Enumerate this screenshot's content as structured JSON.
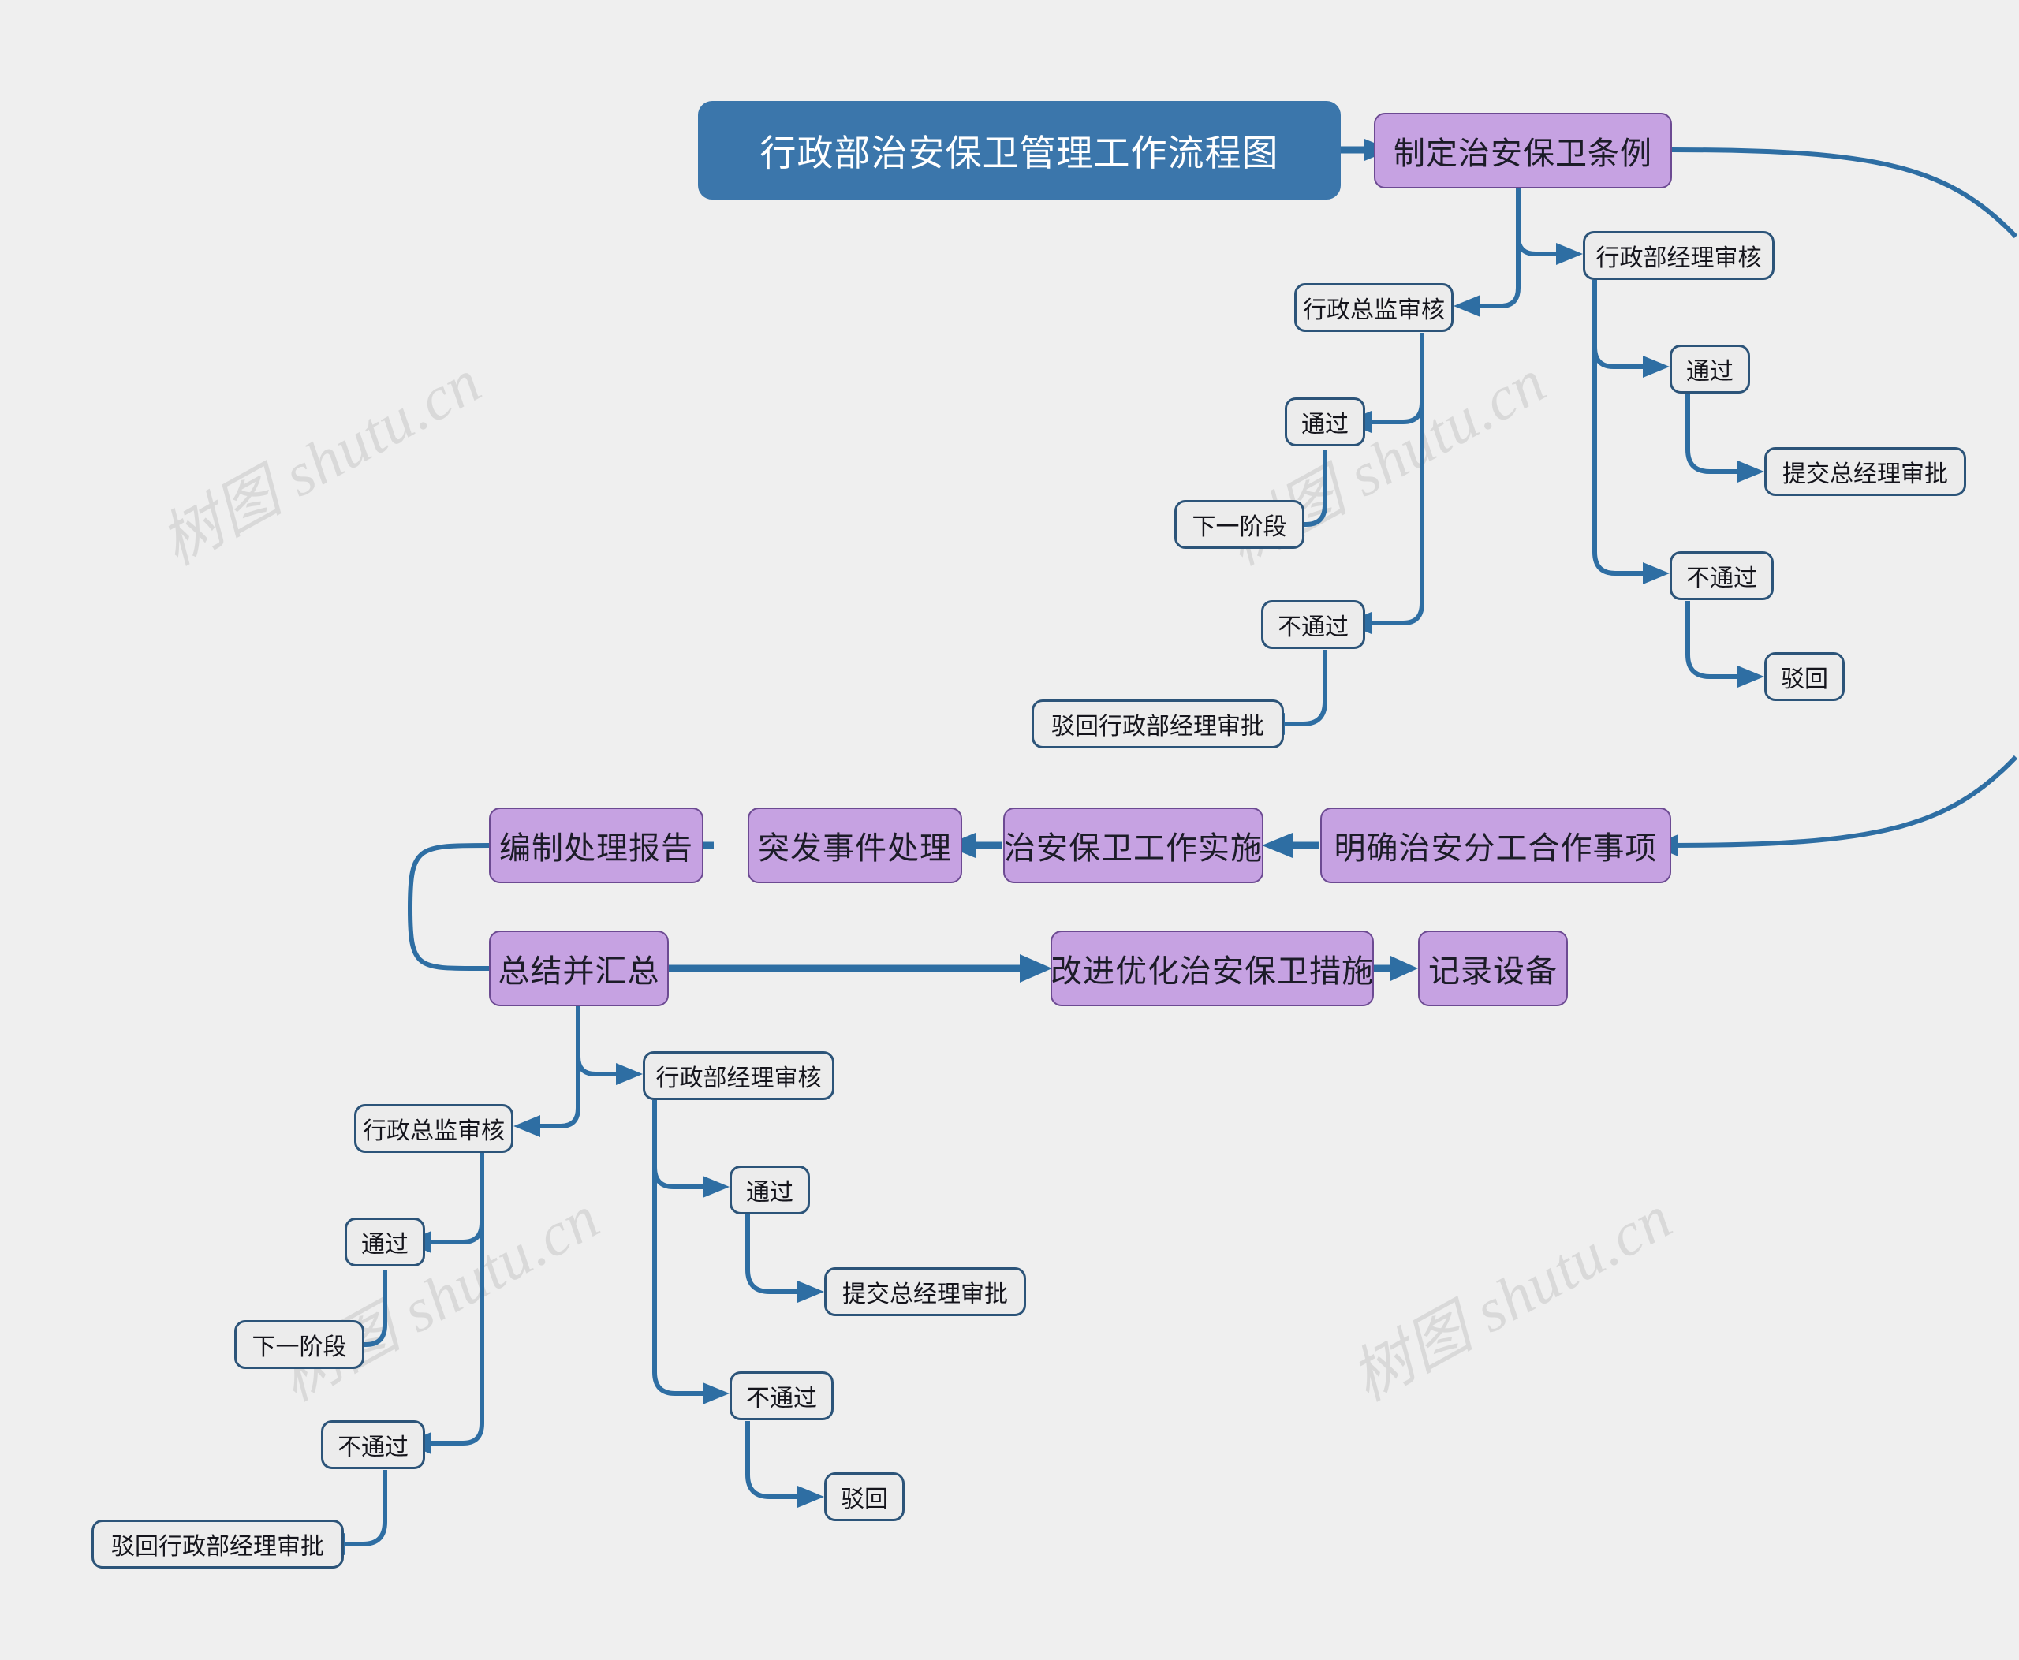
{
  "diagram": {
    "title": "行政部治安保卫管理工作流程图",
    "watermark": "树图 shutu.cn",
    "colors": {
      "background": "#efefef",
      "root_fill": "#3b76ab",
      "root_text": "#ffffff",
      "purple_fill": "#c6a2e2",
      "purple_border": "#6c4a92",
      "gray_fill": "#ececec",
      "gray_border": "#2c5479",
      "edge": "#2e6ea3",
      "watermark_color": "#d9d9d9"
    }
  },
  "nodes": {
    "root": "行政部治安保卫管理工作流程图",
    "top_main": "制定治安保卫条例",
    "top_admin_mgr_review": "行政部经理审核",
    "top_admin_dir_review": "行政总监审核",
    "top_mgr_pass": "通过",
    "top_mgr_submit": "提交总经理审批",
    "top_mgr_fail": "不通过",
    "top_mgr_reject": "驳回",
    "top_dir_pass": "通过",
    "top_dir_next": "下一阶段",
    "top_dir_fail": "不通过",
    "top_dir_reject": "驳回行政部经理审批",
    "mid_cooperate": "明确治安分工合作事项",
    "mid_implement": "治安保卫工作实施",
    "mid_emergency": "突发事件处理",
    "mid_report": "编制处理报告",
    "sum_node": "总结并汇总",
    "improve": "改进优化治安保卫措施",
    "record": "记录设备",
    "bot_admin_mgr_review": "行政部经理审核",
    "bot_admin_dir_review": "行政总监审核",
    "bot_mgr_pass": "通过",
    "bot_mgr_submit": "提交总经理审批",
    "bot_mgr_fail": "不通过",
    "bot_mgr_reject": "驳回",
    "bot_dir_pass": "通过",
    "bot_dir_next": "下一阶段",
    "bot_dir_fail": "不通过",
    "bot_dir_reject": "驳回行政部经理审批"
  },
  "flow": {
    "type": "flowchart",
    "orientation": "mixed",
    "branches": [
      {
        "from": "行政部治安保卫管理工作流程图",
        "to": "制定治安保卫条例"
      },
      {
        "from": "制定治安保卫条例",
        "to": [
          "行政部经理审核",
          "行政总监审核",
          "明确治安分工合作事项"
        ]
      },
      {
        "from": "行政部经理审核",
        "to": [
          "通过",
          "不通过"
        ]
      },
      {
        "from": "通过",
        "to": "提交总经理审批"
      },
      {
        "from": "不通过",
        "to": "驳回"
      },
      {
        "from": "行政总监审核",
        "to": [
          "通过",
          "不通过"
        ]
      },
      {
        "from": "通过",
        "to": "下一阶段"
      },
      {
        "from": "不通过",
        "to": "驳回行政部经理审批"
      },
      {
        "from": "明确治安分工合作事项",
        "to": "治安保卫工作实施"
      },
      {
        "from": "治安保卫工作实施",
        "to": "突发事件处理"
      },
      {
        "from": "突发事件处理",
        "to": "编制处理报告"
      },
      {
        "from": "编制处理报告",
        "to": "总结并汇总"
      },
      {
        "from": "总结并汇总",
        "to": [
          "改进优化治安保卫措施",
          "行政部经理审核",
          "行政总监审核"
        ]
      },
      {
        "from": "改进优化治安保卫措施",
        "to": "记录设备"
      }
    ]
  }
}
